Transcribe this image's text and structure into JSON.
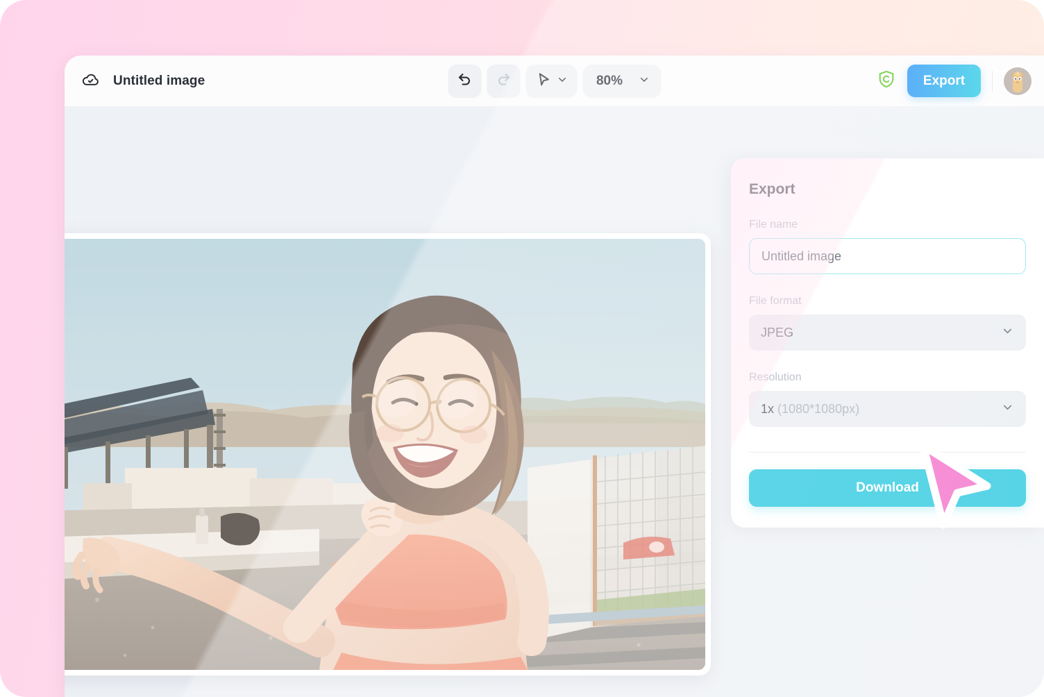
{
  "background": {
    "gradient_from": "#ffd5ec",
    "gradient_to": "#fde9da"
  },
  "topbar": {
    "cloud_icon": "cloud-check-icon",
    "document_title": "Untitled image",
    "undo_label": "Undo",
    "undo_icon": "undo-arrow-icon",
    "redo_label": "Redo",
    "redo_icon": "redo-arrow-icon",
    "cursor_tool_icon": "cursor-arrow-icon",
    "cursor_tool_chevron": "chevron-down-icon",
    "zoom_value": "80%",
    "zoom_chevron": "chevron-down-icon",
    "shield_icon": "green-shield-c-icon",
    "shield_color": "#55c51b",
    "export_label": "Export",
    "export_gradient_from": "#1f8ff5",
    "export_gradient_to": "#1fcbe2",
    "avatar_name": "user-avatar"
  },
  "canvas": {
    "background_color": "#eef1f5",
    "image_alt": "Smiling woman with glasses stretching her arm on a sunny rooftop"
  },
  "export_panel": {
    "title": "Export",
    "file_name": {
      "label": "File name",
      "value": "Untitled image",
      "placeholder": "Untitled image",
      "focus_color": "#7fe0ea"
    },
    "file_format": {
      "label": "File format",
      "value": "JPEG",
      "chevron": "chevron-down-icon"
    },
    "resolution": {
      "label": "Resolution",
      "value_primary": "1x",
      "value_secondary": "(1080*1080px)",
      "chevron": "chevron-down-icon"
    },
    "download_label": "Download",
    "download_color": "#1fc6de"
  },
  "cursor": {
    "name": "pointer-cursor",
    "color": "#f368c8"
  }
}
